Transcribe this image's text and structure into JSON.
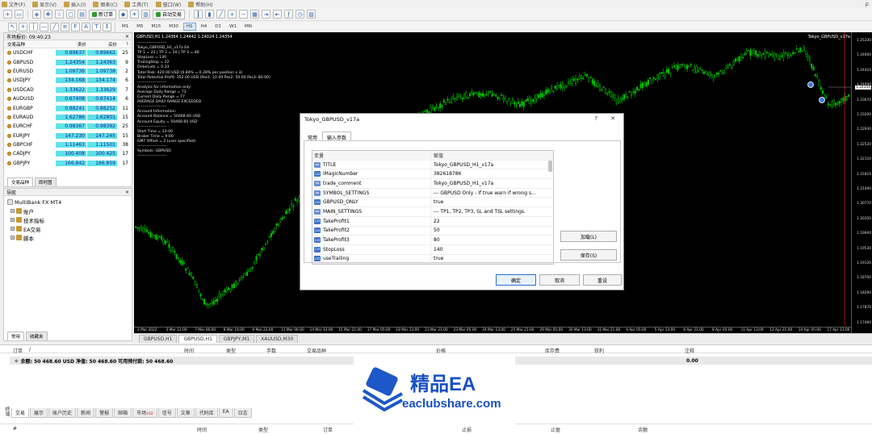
{
  "menu": {
    "items": [
      "文件(F)",
      "显示(V)",
      "插入(I)",
      "图表(C)",
      "工具(T)",
      "窗口(W)",
      "帮助(H)"
    ],
    "right": "ρ"
  },
  "toolbar": {
    "new_order": "新订单",
    "auto_trade": "自动交易"
  },
  "timeframes": [
    "M1",
    "M5",
    "M15",
    "M30",
    "H1",
    "H4",
    "D1",
    "W1",
    "MN"
  ],
  "timeframe_active": "H1",
  "market_watch": {
    "title": "市场报价: 09:40:23",
    "headers": {
      "symbol": "交易品种",
      "bid": "卖价",
      "ask": "买价",
      "spread": "!"
    },
    "rows": [
      {
        "symbol": "USDCHF",
        "bid": "0.89637",
        "ask": "0.89662",
        "spread": "25"
      },
      {
        "symbol": "GBPUSD",
        "bid": "1.24354",
        "ask": "1.24363",
        "spread": "9"
      },
      {
        "symbol": "EURUSD",
        "bid": "1.09736",
        "ask": "1.09738",
        "spread": "2"
      },
      {
        "symbol": "USDJPY",
        "bid": "134.168",
        "ask": "134.174",
        "spread": "6"
      },
      {
        "symbol": "USDCAD",
        "bid": "1.33622",
        "ask": "1.33629",
        "spread": "7"
      },
      {
        "symbol": "AUDUSD",
        "bid": "0.67408",
        "ask": "0.67414",
        "spread": "6"
      },
      {
        "symbol": "EURGBP",
        "bid": "0.88241",
        "ask": "0.88252",
        "spread": "11"
      },
      {
        "symbol": "EURAUD",
        "bid": "1.62786",
        "ask": "1.62801",
        "spread": "15"
      },
      {
        "symbol": "EURCHF",
        "bid": "0.98367",
        "ask": "0.98392",
        "spread": "25"
      },
      {
        "symbol": "EURJPY",
        "bid": "147.230",
        "ask": "147.245",
        "spread": "15"
      },
      {
        "symbol": "GBPCHF",
        "bid": "1.11463",
        "ask": "1.11501",
        "spread": "38"
      },
      {
        "symbol": "CADJPY",
        "bid": "100.408",
        "ask": "100.425",
        "spread": "17"
      },
      {
        "symbol": "GBPJPY",
        "bid": "166.842",
        "ask": "166.859",
        "spread": "17"
      }
    ],
    "tabs": [
      "交易品种",
      "即时图"
    ]
  },
  "navigator": {
    "title": "导航",
    "root": "MultiBank FX MT4",
    "items": [
      "账户",
      "技术指标",
      "EA交易",
      "脚本"
    ],
    "tabs": [
      "常用",
      "收藏夹"
    ]
  },
  "chart": {
    "header": "GBPUSD,H1  1.24364 1.24442 1.24024 1.24354",
    "ea_name": "Tokyo_GBPUSD_v17a",
    "overlay": [
      "----------------------",
      "Tokyo_GBPUSD_H1_v17a EA",
      "TP 1 = 22 | TP 2 = 50 | TP 3 = 80",
      "StopLoss = 140",
      "TrailingStop = 22",
      "OrderLots = 0.33",
      "Total Risk: 420.00 USD (0.84% = 0.28% per position x 3)",
      "Total Potential Profit: 352.00 USD (Pos1: 22.00 Pos2: 50.00 Pos3: 80.00)",
      "----------------------",
      "Analysis for information only:",
      "Average Daily Range = 73",
      "Current Daily Range = 77",
      "AVERAGE DAILY RANGE EXCEEDED",
      "----------------------",
      "Account Information:",
      "Account Balance = 50468.60 USD",
      "Account Equity = 50468.60 USD",
      "----------------------",
      "Start Time = 23:00",
      "Broker Time = 9:00",
      "GMT Offset = 2 (user specified)",
      "----------------------",
      "Symbols: GBPUSD",
      "----------------------"
    ],
    "y_ticks": [
      "1.25330",
      "1.24600",
      "1.24410",
      "1.24090",
      "1.23670",
      "1.23200",
      "1.22930",
      "1.22520",
      "1.22110",
      "1.21810",
      "1.21400",
      "1.20770",
      "1.20350",
      "1.19940",
      "1.19530",
      "1.19120",
      "1.18700",
      "1.18290",
      "1.17870",
      "1.17460"
    ],
    "price_marker": "1.24354",
    "x_ticks": [
      "2 Mar 2022",
      "3 Mar 12:00",
      "7 Mar 06:00",
      "8 Mar 14:00",
      "9 Mar 22:00",
      "11 Mar 06:00",
      "14 Mar 13:00",
      "15 Mar 21:00",
      "17 Mar 05:00",
      "18 Mar 13:00",
      "21 Mar 21:00",
      "23 Mar 05:00",
      "24 Mar 13:00",
      "25 Mar 21:00",
      "29 Mar 05:00",
      "30 Mar 13:00",
      "31 Mar 21:00",
      "4 Apr 05:00",
      "5 Apr 13:00",
      "6 Apr 21:00",
      "8 Apr 05:00",
      "11 Apr 13:00",
      "12 Apr 21:00",
      "14 Apr 05:00",
      "17 Apr 13:00"
    ]
  },
  "chart_tabs": [
    "GBPUSD,H1",
    "GBPUSD,H1",
    "GBPJPY,M1",
    "XAUUSD,M30"
  ],
  "chart_tab_active": 1,
  "dialog": {
    "title": "Tokyo_GBPUSD_v17a",
    "tabs": [
      "常用",
      "输入参数"
    ],
    "active_tab": 1,
    "columns": [
      "变量",
      "赋值"
    ],
    "params": [
      {
        "icon": "ab",
        "name": "TITLE",
        "value": "Tokyo_GBPUSD_H1_v17a"
      },
      {
        "icon": "123",
        "name": "iMagicNumber",
        "value": "382618786"
      },
      {
        "icon": "ab",
        "name": "trade_comment",
        "value": "Tokyo_GBPUSD_H1_v17a"
      },
      {
        "icon": "ab",
        "name": "SYMBOL_SETTINGS",
        "value": "--- GBPUSD Only - If true warn if wrong s..."
      },
      {
        "icon": "123",
        "name": "GBPUSD_ONLY",
        "value": "true"
      },
      {
        "icon": "ab",
        "name": "MAIN_SETTINGS",
        "value": "--- TP1, TP2, TP3, SL and TSL settings."
      },
      {
        "icon": "123",
        "name": "TakeProfit1",
        "value": "22"
      },
      {
        "icon": "123",
        "name": "TakeProfit2",
        "value": "50"
      },
      {
        "icon": "123",
        "name": "TakeProfit3",
        "value": "80"
      },
      {
        "icon": "123",
        "name": "StopLoss",
        "value": "140"
      },
      {
        "icon": "123",
        "name": "useTrailing",
        "value": "true"
      }
    ],
    "load_label": "加载(L)",
    "save_label": "保存(S)",
    "ok_label": "确定",
    "cancel_label": "取消",
    "reset_label": "重设"
  },
  "terminal": {
    "headers": [
      "订单",
      "/",
      "时间",
      "类型",
      "手数",
      "交易品种",
      "价格",
      "库存费",
      "获利",
      "注释"
    ],
    "balance_line": "余额: 50 468.60 USD  净值: 50 468.60  可用预付款: 50 468.60",
    "balance_profit": "0.00",
    "tabs": [
      "交易",
      "展示",
      "账户历史",
      "新闻",
      "警报",
      "邮箱",
      "市场",
      "信号",
      "文章",
      "代码库",
      "EA",
      "日志"
    ],
    "market_badge": "102",
    "side_label": "终端",
    "headers2": [
      "#",
      "时间",
      "类型",
      "订单",
      "止损",
      "止盈",
      "余额"
    ]
  },
  "watermark": {
    "title": "精品EA",
    "url": "eaclubshare.com"
  }
}
